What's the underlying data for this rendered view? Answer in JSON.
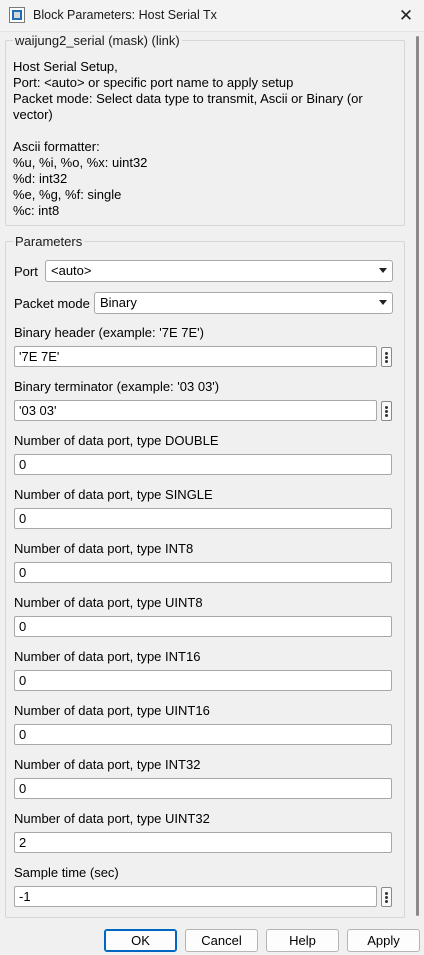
{
  "window": {
    "title": "Block Parameters: Host Serial Tx",
    "close_glyph": "✕"
  },
  "description_group": {
    "title": "waijung2_serial (mask) (link)",
    "lines": [
      "Host Serial Setup,",
      "Port: <auto> or specific port name to apply setup",
      "Packet mode: Select data type to transmit, Ascii or Binary (or",
      "vector)",
      "",
      "Ascii formatter:",
      "%u, %i, %o, %x: uint32",
      "%d: int32",
      "%e, %g, %f: single",
      "%c: int8"
    ]
  },
  "parameters_group": {
    "title": "Parameters",
    "port": {
      "label": "Port",
      "value": "<auto>"
    },
    "packet_mode": {
      "label": "Packet mode",
      "value": "Binary"
    },
    "binary_header": {
      "label": "Binary header (example: '7E 7E')",
      "value": "'7E 7E'"
    },
    "binary_terminator": {
      "label": "Binary terminator (example: '03 03')",
      "value": "'03 03'"
    },
    "data_ports": [
      {
        "label": "Number of data port, type DOUBLE",
        "value": "0"
      },
      {
        "label": "Number of data port, type SINGLE",
        "value": "0"
      },
      {
        "label": "Number of data port, type INT8",
        "value": "0"
      },
      {
        "label": "Number of data port, type UINT8",
        "value": "0"
      },
      {
        "label": "Number of data port, type INT16",
        "value": "0"
      },
      {
        "label": "Number of data port, type UINT16",
        "value": "0"
      },
      {
        "label": "Number of data port, type INT32",
        "value": "0"
      },
      {
        "label": "Number of data port, type UINT32",
        "value": "2"
      }
    ],
    "sample_time": {
      "label": "Sample time (sec)",
      "value": "-1"
    }
  },
  "buttons": {
    "ok": "OK",
    "cancel": "Cancel",
    "help": "Help",
    "apply": "Apply"
  },
  "icons": {
    "window_icon": "block-parameters-icon",
    "close": "close-icon",
    "dropdown": "chevron-down-icon",
    "more": "vertical-ellipsis-icon"
  },
  "colors": {
    "background": "#f0f0f0",
    "primary_button_border": "#0067c0"
  }
}
